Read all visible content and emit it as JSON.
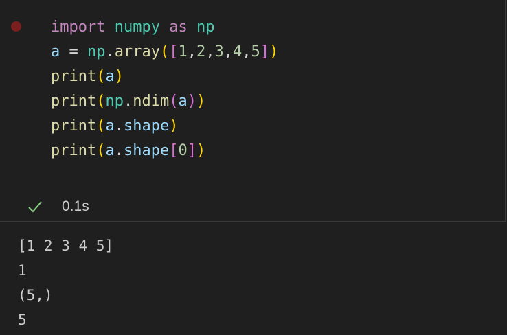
{
  "cell": {
    "code_lines": [
      [
        {
          "t": "import",
          "c": "kw"
        },
        {
          "t": " ",
          "c": "op"
        },
        {
          "t": "numpy",
          "c": "mod"
        },
        {
          "t": " ",
          "c": "op"
        },
        {
          "t": "as",
          "c": "kw"
        },
        {
          "t": " ",
          "c": "op"
        },
        {
          "t": "np",
          "c": "mod"
        }
      ],
      [
        {
          "t": "a",
          "c": "var"
        },
        {
          "t": " = ",
          "c": "op"
        },
        {
          "t": "np",
          "c": "mod"
        },
        {
          "t": ".",
          "c": "op"
        },
        {
          "t": "array",
          "c": "fn"
        },
        {
          "t": "(",
          "c": "b1"
        },
        {
          "t": "[",
          "c": "b2"
        },
        {
          "t": "1",
          "c": "num"
        },
        {
          "t": ",",
          "c": "op"
        },
        {
          "t": "2",
          "c": "num"
        },
        {
          "t": ",",
          "c": "op"
        },
        {
          "t": "3",
          "c": "num"
        },
        {
          "t": ",",
          "c": "op"
        },
        {
          "t": "4",
          "c": "num"
        },
        {
          "t": ",",
          "c": "op"
        },
        {
          "t": "5",
          "c": "num"
        },
        {
          "t": "]",
          "c": "b2"
        },
        {
          "t": ")",
          "c": "b1"
        }
      ],
      [
        {
          "t": "print",
          "c": "fn"
        },
        {
          "t": "(",
          "c": "b1"
        },
        {
          "t": "a",
          "c": "var"
        },
        {
          "t": ")",
          "c": "b1"
        }
      ],
      [
        {
          "t": "print",
          "c": "fn"
        },
        {
          "t": "(",
          "c": "b1"
        },
        {
          "t": "np",
          "c": "mod"
        },
        {
          "t": ".",
          "c": "op"
        },
        {
          "t": "ndim",
          "c": "fn"
        },
        {
          "t": "(",
          "c": "b2"
        },
        {
          "t": "a",
          "c": "var"
        },
        {
          "t": ")",
          "c": "b2"
        },
        {
          "t": ")",
          "c": "b1"
        }
      ],
      [
        {
          "t": "print",
          "c": "fn"
        },
        {
          "t": "(",
          "c": "b1"
        },
        {
          "t": "a",
          "c": "var"
        },
        {
          "t": ".",
          "c": "op"
        },
        {
          "t": "shape",
          "c": "var"
        },
        {
          "t": ")",
          "c": "b1"
        }
      ],
      [
        {
          "t": "print",
          "c": "fn"
        },
        {
          "t": "(",
          "c": "b1"
        },
        {
          "t": "a",
          "c": "var"
        },
        {
          "t": ".",
          "c": "op"
        },
        {
          "t": "shape",
          "c": "var"
        },
        {
          "t": "[",
          "c": "b2"
        },
        {
          "t": "0",
          "c": "num"
        },
        {
          "t": "]",
          "c": "b2"
        },
        {
          "t": ")",
          "c": "b1"
        }
      ]
    ],
    "status": {
      "icon": "check-icon",
      "time": "0.1s",
      "color": "#89d185"
    }
  },
  "output": {
    "lines": [
      "[1 2 3 4 5]",
      "1",
      "(5,)",
      "5"
    ]
  }
}
